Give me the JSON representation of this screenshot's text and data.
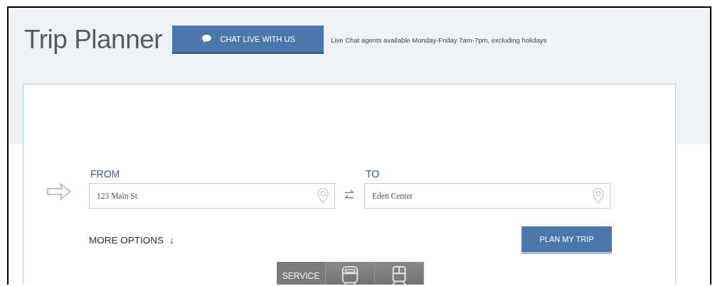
{
  "header": {
    "title": "Trip Planner",
    "chat_button": "CHAT LIVE WITH US",
    "chat_note": "Live Chat agents available Monday-Friday 7am-7pm, excluding holidays"
  },
  "planner": {
    "from": {
      "label": "FROM",
      "value": "123 Main St"
    },
    "to": {
      "label": "TO",
      "value": "Eden Center"
    },
    "more_options": "MORE OPTIONS",
    "more_options_arrow": "↓",
    "plan_button": "PLAN MY TRIP"
  },
  "mode_tabs": [
    {
      "kind": "text",
      "label": "SERVICE"
    },
    {
      "kind": "bus"
    },
    {
      "kind": "train"
    }
  ]
}
